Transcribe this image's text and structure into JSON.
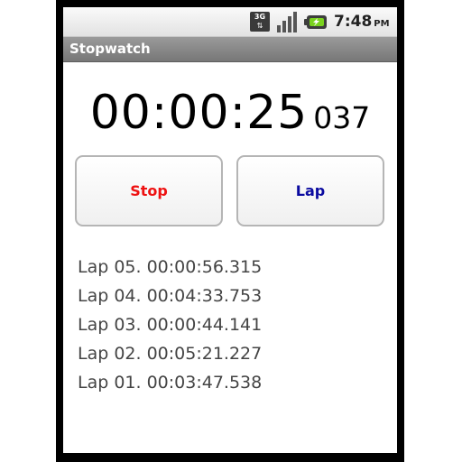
{
  "status_bar": {
    "network_label": "3G",
    "network_icon": "3g-data-icon",
    "signal_icon": "signal-strength-icon",
    "battery_icon": "battery-charging-icon",
    "time": "7:48",
    "ampm": "PM"
  },
  "app": {
    "title": "Stopwatch"
  },
  "timer": {
    "main": "00:00:25",
    "milliseconds": "037"
  },
  "buttons": {
    "stop_label": "Stop",
    "lap_label": "Lap"
  },
  "colors": {
    "stop": "#ee1111",
    "lap": "#0a0aa0",
    "title_bar": "#888888"
  },
  "laps": [
    "Lap 05. 00:00:56.315",
    "Lap 04. 00:04:33.753",
    "Lap 03. 00:00:44.141",
    "Lap 02. 00:05:21.227",
    "Lap 01. 00:03:47.538"
  ]
}
